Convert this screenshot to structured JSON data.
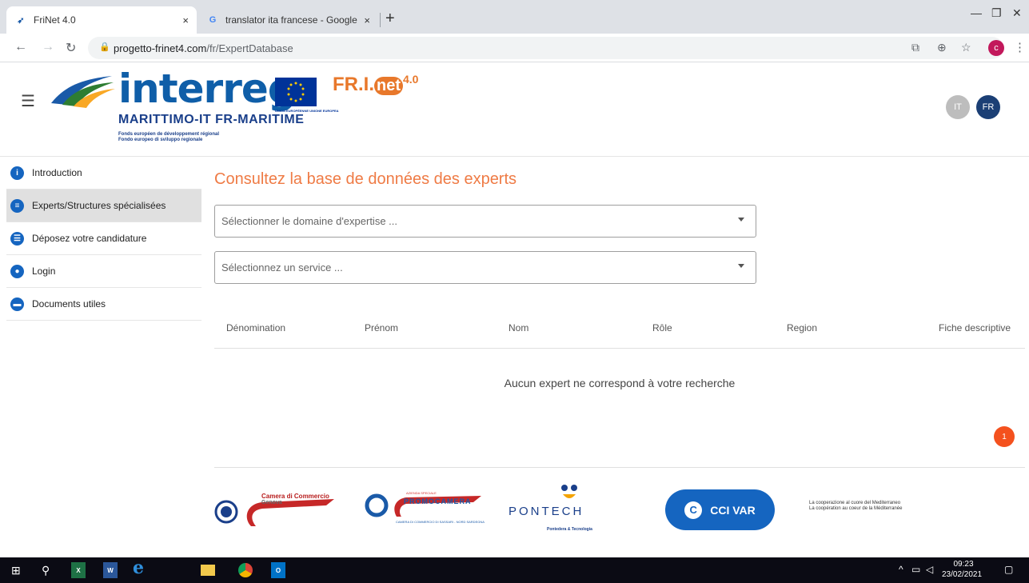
{
  "browser": {
    "tabs": [
      {
        "title": "FriNet 4.0",
        "close": "×"
      },
      {
        "title": "translator ita francese - Google S",
        "close": "×"
      }
    ],
    "new_tab": "+",
    "url_host": "progetto-frinet4.com",
    "url_path": "/fr/ExpertDatabase",
    "profile_initial": "c"
  },
  "header": {
    "logo_word": "interreg",
    "eu_caption": "UNION EUROPÉENNE UNIONE EUROPEA",
    "program": "MARITTIMO-IT FR-MARITIME",
    "fund_fr": "Fonds européen de développement régional",
    "fund_it": "Fondo europeo di sviluppo regionale",
    "frinet_prefix": "FR.I.",
    "frinet_net": "net",
    "frinet_version": "4.0",
    "lang_it": "IT",
    "lang_fr": "FR"
  },
  "sidebar": {
    "items": [
      {
        "label": "Introduction",
        "icon": "info-icon",
        "glyph": "i"
      },
      {
        "label": "Experts/Structures spécialisées",
        "icon": "experts-icon",
        "glyph": "≡"
      },
      {
        "label": "Déposez votre candidature",
        "icon": "apply-icon",
        "glyph": "☰"
      },
      {
        "label": "Login",
        "icon": "user-icon",
        "glyph": "●"
      },
      {
        "label": "Documents utiles",
        "icon": "folder-icon",
        "glyph": "▬"
      }
    ]
  },
  "main": {
    "title": "Consultez la base de données des experts",
    "domain_placeholder": "Sélectionner le domaine d'expertise ...",
    "service_placeholder": "Sélectionnez un service ...",
    "columns": [
      "Dénomination",
      "Prénom",
      "Nom",
      "Rôle",
      "Region",
      "Fiche descriptive"
    ],
    "empty_message": "Aucun expert ne correspond à votre recherche",
    "page_number": "1"
  },
  "footer": {
    "ccm_name": "Camera di Commercio",
    "ccm_city": "Genova",
    "promo_top": "AZIENDA SPECIALE",
    "promo_name": "PROMOCAMERA",
    "promo_sub": "CAMERA DI COMMERCIO DI SASSARI - NORD SARDEGNA",
    "pontech_name": "PONTECH",
    "pontech_sub": "Pontedera & Tecnologia",
    "cci_name": "CCI VAR",
    "coop_it": "La cooperazione al cuore del Mediterraneo",
    "coop_fr": "La coopération au coeur de la Méditerranée"
  },
  "taskbar": {
    "time": "09:23",
    "date": "23/02/2021"
  }
}
